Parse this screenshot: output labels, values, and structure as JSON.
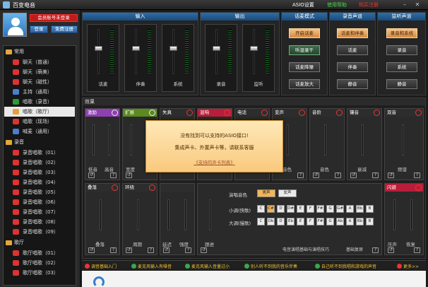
{
  "titlebar": {
    "title": "百变电音",
    "asio_settings": "ASIO设置",
    "help": "使用帮助",
    "buy": "购买注册"
  },
  "user": {
    "account_label": "会员账号未登录",
    "login": "登录",
    "register": "免费注册"
  },
  "tree": {
    "categories": [
      "常用",
      "录音",
      "歌厅"
    ],
    "common": [
      "聊天（普通）",
      "聊天（萌美）",
      "聊天（磁性）",
      "主持（通用）",
      "唱歌（录音）",
      "唱歌（歌厅）",
      "唱歌（现场）",
      "喊麦（通用）"
    ],
    "recording": [
      "录音唱歌（01）",
      "录音唱歌（02）",
      "录音唱歌（03）",
      "录音唱歌（04）",
      "录音唱歌（05）",
      "录音唱歌（06）",
      "录音唱歌（07）",
      "录音唱歌（08）",
      "录音唱歌（09）"
    ],
    "ktv": [
      "歌厅唱歌（01）",
      "歌厅唱歌（02）",
      "歌厅唱歌（03）"
    ]
  },
  "input": {
    "title": "输入",
    "channels": [
      "话麦",
      "伴奏",
      "系统"
    ]
  },
  "output": {
    "title": "输出",
    "channels": [
      "录音",
      "监听"
    ]
  },
  "mode": {
    "title": "话麦模式",
    "buttons": [
      "开启话麦",
      "听混录干",
      "话麦降噪",
      "话麦放大"
    ]
  },
  "record_src": {
    "title": "录音声道",
    "buttons": [
      "话麦和伴奏",
      "话麦",
      "伴奏",
      "静音"
    ]
  },
  "monitor_src": {
    "title": "监听声道",
    "buttons": [
      "录音和系统",
      "录音",
      "系统",
      "静音"
    ]
  },
  "effects": {
    "title": "效果",
    "top": [
      {
        "name": "激励",
        "color": "#8e3fb0",
        "labels": [
          "低音",
          "高音"
        ]
      },
      {
        "name": "扩展",
        "color": "#5b8a1e",
        "labels": [
          "宽度"
        ]
      },
      {
        "name": "失真",
        "color": "#2d2d2d",
        "labels": []
      },
      {
        "name": "混响",
        "color": "#b81e3a",
        "labels": []
      },
      {
        "name": "电话",
        "color": "#2d2d2d",
        "labels": []
      },
      {
        "name": "变声",
        "color": "#2d2d2d",
        "labels": [
          "音色"
        ]
      },
      {
        "name": "音阶",
        "color": "#2d2d2d",
        "labels": [
          "音色"
        ]
      },
      {
        "name": "镶音",
        "color": "#2d2d2d",
        "labels": [
          "衰减"
        ]
      },
      {
        "name": "双音",
        "color": "#2d2d2d",
        "labels": [
          "频谱"
        ]
      }
    ],
    "bottom": [
      {
        "name": "叠落",
        "color": "#2d2d2d",
        "labels": [
          "叠落"
        ]
      },
      {
        "name": "环绕",
        "color": "#2d2d2d",
        "labels": [
          "周期"
        ]
      },
      {
        "name": "",
        "color": "#2d2d2d",
        "labels": [
          "延迟",
          "强度"
        ]
      },
      {
        "name": "闪避",
        "color": "#b81e3a",
        "labels": [
          "压声",
          "恢复"
        ]
      }
    ],
    "scale": {
      "voice_label": "演唱音色",
      "male": "男声",
      "female": "女声",
      "minor_label": "小调(快歌)",
      "major_label": "大调(慢歌)",
      "minor_keys": [
        "C",
        "C#",
        "D",
        "D#",
        "E",
        "F",
        "F#",
        "G",
        "G#",
        "A",
        "Bb",
        "B"
      ],
      "major_keys": [
        "C",
        "Db",
        "D",
        "Eb",
        "E",
        "F",
        "F#",
        "G",
        "Ab",
        "A",
        "Bb",
        "B"
      ],
      "track_hint": "电音演唱基础与演唱技巧",
      "reset": "基础复原",
      "adjust": "跟进"
    }
  },
  "popup": {
    "line1": "没有找到可以支持的ASIO接口!",
    "line2": "集成声卡、外置声卡等，请联系客服",
    "link": "《支持的声卡列表》"
  },
  "tips": [
    "调音基础入门",
    "麦克风输入有噪音",
    "麦克风输入音量过小",
    "别人听不到我的音乐伴奏",
    "自己听不到我唱和游戏的声音",
    "更多>>"
  ]
}
